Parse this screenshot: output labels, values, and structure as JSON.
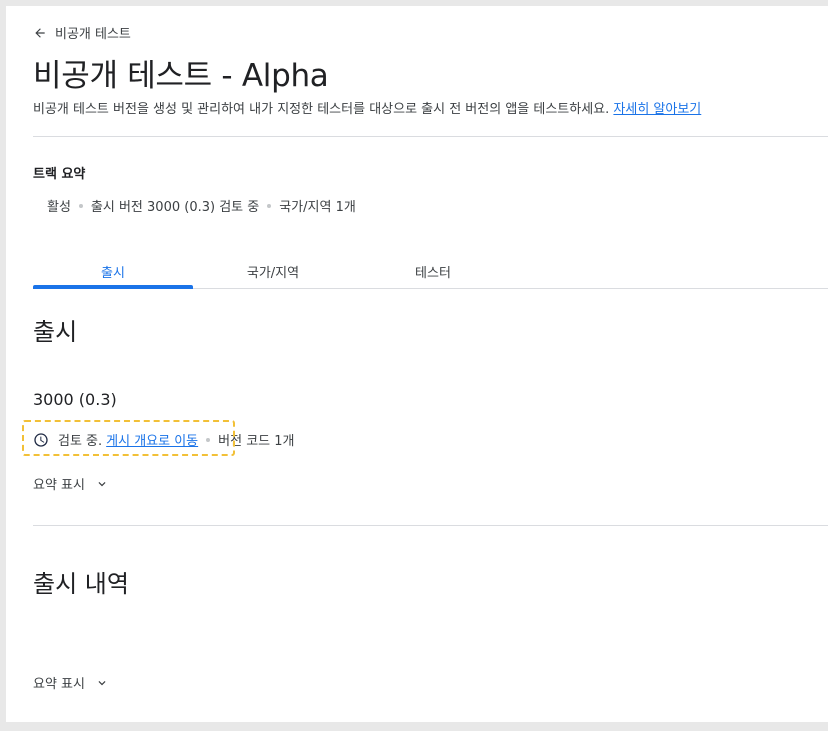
{
  "header": {
    "back_label": "비공개 테스트",
    "title": "비공개 테스트 - Alpha",
    "description": "비공개 테스트 버전을 생성 및 관리하여 내가 지정한 테스터를 대상으로 출시 전 버전의 앱을 테스트하세요.",
    "learn_more": "자세히 알아보기"
  },
  "track_summary": {
    "title": "트랙 요약",
    "status": "활성",
    "release": "출시 버전 3000 (0.3) 검토 중",
    "countries": "국가/지역 1개"
  },
  "tabs": [
    {
      "label": "출시",
      "active": true
    },
    {
      "label": "국가/지역",
      "active": false
    },
    {
      "label": "테스터",
      "active": false
    }
  ],
  "release_section": {
    "title": "출시",
    "version": "3000 (0.3)",
    "status_text": "검토 중.",
    "status_link": "게시 개요로 이동",
    "version_codes": "버전 코드 1개",
    "show_summary": "요약 표시"
  },
  "history_section": {
    "title": "출시 내역",
    "show_summary": "요약 표시"
  },
  "colors": {
    "accent": "#1a73e8",
    "highlight": "#f2c037"
  }
}
